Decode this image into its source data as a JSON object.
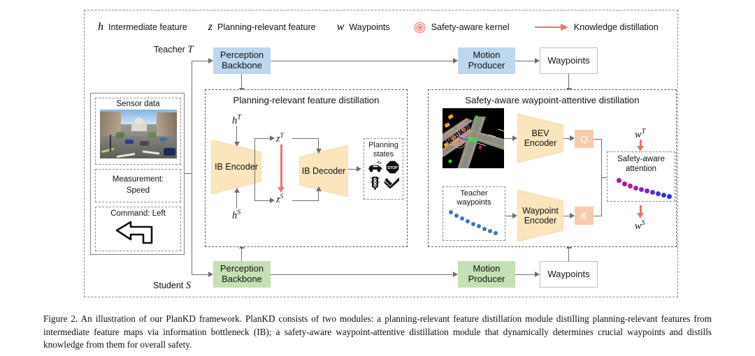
{
  "figure": {
    "caption": "Figure 2. An illustration of our PlanKD framework. PlanKD consists of two modules: a planning-relevant feature distillation module distilling planning-relevant features from intermediate feature maps via information bottleneck (IB); a safety-aware waypoint-attentive distillation module that dynamically determines crucial waypoints and distills knowledge from them for overall safety."
  },
  "legend": {
    "items": [
      {
        "symbol": "h",
        "label": "Intermediate feature",
        "icon": "italic-h-symbol"
      },
      {
        "symbol": "z",
        "label": "Planning-relevant feature",
        "icon": "italic-z-symbol"
      },
      {
        "symbol": "w",
        "label": "Waypoints",
        "icon": "italic-w-symbol"
      },
      {
        "symbol": "",
        "label": "Safety-aware  kernel",
        "icon": "safety-kernel-icon"
      },
      {
        "symbol": "",
        "label": "Knowledge distillation",
        "icon": "red-arrow-icon"
      }
    ]
  },
  "pipelines": {
    "teacher": {
      "role": "Teacher",
      "role_symbol": "T",
      "backbone": "Perception\nBackbone",
      "backbone_line1": "Perception",
      "backbone_line2": "Backbone",
      "producer_line1": "Motion",
      "producer_line2": "Producer",
      "waypoints": "Waypoints",
      "color": "#bdd7ee"
    },
    "student": {
      "role": "Student",
      "role_symbol": "S",
      "backbone_line1": "Perception",
      "backbone_line2": "Backbone",
      "producer_line1": "Motion",
      "producer_line2": "Producer",
      "waypoints": "Waypoints",
      "color": "#c5e0b4"
    }
  },
  "inputs": {
    "sensor": {
      "title": "Sensor data",
      "image": "street-scene-image"
    },
    "measurement": {
      "line1": "Measurement:",
      "line2": "Speed"
    },
    "command": {
      "label": "Command: Left",
      "icon": "left-turn-arrow-icon"
    }
  },
  "module_feature": {
    "title": "Planning-relevant feature distillation",
    "encoder": "IB Encoder",
    "decoder": "IB Decoder",
    "h_teacher": "h",
    "h_teacher_sup": "T",
    "h_student": "h",
    "h_student_sup": "S",
    "z_teacher": "z",
    "z_teacher_sup": "T",
    "z_student": "z",
    "z_student_sup": "S",
    "planning_states": {
      "line1": "Planning",
      "line2": "states",
      "icons": [
        "car-icon",
        "stop-sign-icon",
        "traffic-light-icon",
        "check-arrow-icon"
      ]
    }
  },
  "module_safety": {
    "title": "Safety-aware waypoint-attentive distillation",
    "bev_image": "bev-map-image",
    "bev_encoder_line1": "BEV",
    "bev_encoder_line2": "Encoder",
    "waypoint_encoder_line1": "Waypoint",
    "waypoint_encoder_line2": "Encoder",
    "teacher_waypoints_line1": "Teacher",
    "teacher_waypoints_line2": "waypoints",
    "query": "Q",
    "key": "K",
    "attention_line1": "Safety-aware",
    "attention_line2": "attention",
    "w_teacher": "w",
    "w_teacher_sup": "T",
    "w_student": "w",
    "w_student_sup": "S"
  },
  "colors": {
    "teacher_box": "#bdd7ee",
    "student_box": "#c5e0b4",
    "encoder_trapezoid": "#fbe5bd",
    "qk_box": "#f8cbad",
    "distill_red": "#f4706b",
    "connector_gray": "#6f6f6f",
    "frame_dash": "#8a8a8a"
  }
}
